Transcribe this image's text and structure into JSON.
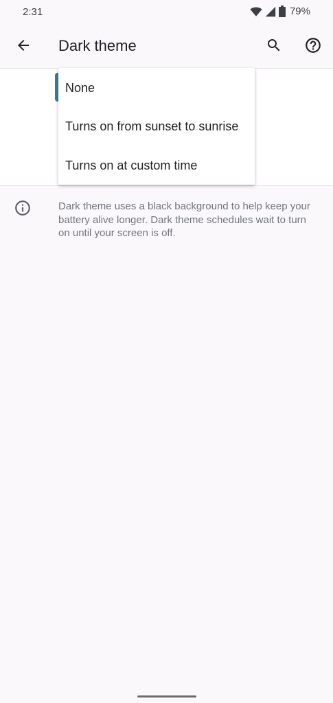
{
  "status_bar": {
    "time": "2:31",
    "battery": "79%",
    "icons": [
      "wifi-icon",
      "signal-icon",
      "battery-icon"
    ]
  },
  "app_bar": {
    "title": "Dark theme",
    "icons": {
      "back": "arrow-back-icon",
      "search": "search-icon",
      "help": "help-icon"
    }
  },
  "dropdown": {
    "items": [
      {
        "label": "None"
      },
      {
        "label": "Turns on from sunset to sunrise"
      },
      {
        "label": "Turns on at custom time"
      }
    ]
  },
  "info": {
    "icon": "info-icon",
    "text": "Dark theme uses a black background to help keep your battery alive longer. Dark theme schedules wait to turn on until your screen is off."
  },
  "colors": {
    "background": "#fbf8fb",
    "accent": "#3b7d9a",
    "text_primary": "#202124",
    "text_secondary": "#70757a"
  }
}
